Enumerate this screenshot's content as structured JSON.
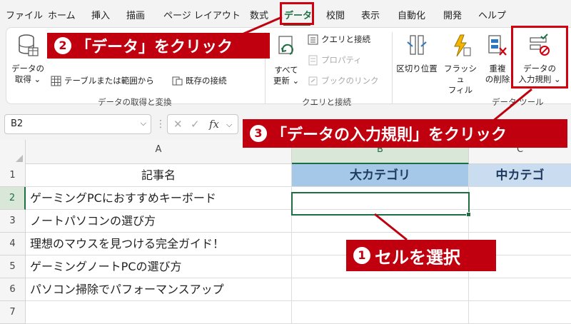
{
  "menu": {
    "tabs": [
      "ファイル",
      "ホーム",
      "挿入",
      "描画",
      "ページ レイアウト",
      "数式",
      "データ",
      "校閲",
      "表示",
      "自動化",
      "開発",
      "ヘルプ"
    ],
    "active_tab": "データ"
  },
  "ribbon": {
    "get_data": {
      "label_line1": "データの",
      "label_line2": "取得 ⌄"
    },
    "from_table": "テーブルまたは範囲から",
    "existing_connections": "既存の接続",
    "group_get_transform": "データの取得と変換",
    "refresh_all": {
      "label_line1": "すべて",
      "label_line2": "更新 ⌄"
    },
    "queries_connections": "クエリと接続",
    "properties": "プロパティ",
    "edit_links": "ブックのリンク",
    "group_queries": "クエリと接続",
    "text_to_columns": "区切り位置",
    "flash_fill": {
      "label_line1": "フラッシュ",
      "label_line2": "フィル"
    },
    "remove_duplicates": {
      "label_line1": "重複",
      "label_line2": "の削除"
    },
    "data_validation": {
      "label_line1": "データの",
      "label_line2": "入力規則 ⌄"
    },
    "group_data_tools": "データ ツール"
  },
  "formula_bar": {
    "name_box": "B2",
    "fx": "fx"
  },
  "sheet": {
    "columns": [
      "A",
      "B",
      "C"
    ],
    "row_numbers": [
      "1",
      "2",
      "3",
      "4",
      "5",
      "6",
      "7"
    ],
    "header_a": "記事名",
    "header_b": "大カテゴリ",
    "header_c": "中カテゴ",
    "articles": [
      "ゲーミングPCにおすすめキーボード",
      "ノートパソコンの選び方",
      "理想のマウスを見つける完全ガイド！",
      "ゲーミングノートPCの選び方",
      "パソコン掃除でパフォーマンスアップ"
    ],
    "selected_cell": "B2"
  },
  "annotations": {
    "step1": {
      "num": "1",
      "text": "セルを選択"
    },
    "step2": {
      "num": "2",
      "text": "「データ」をクリック"
    },
    "step3": {
      "num": "3",
      "text": "「データの入力規則」をクリック"
    }
  },
  "colors": {
    "accent_green": "#1d6f42",
    "annotation_red": "#c0000e",
    "header_blue": "#a6c8e8"
  }
}
